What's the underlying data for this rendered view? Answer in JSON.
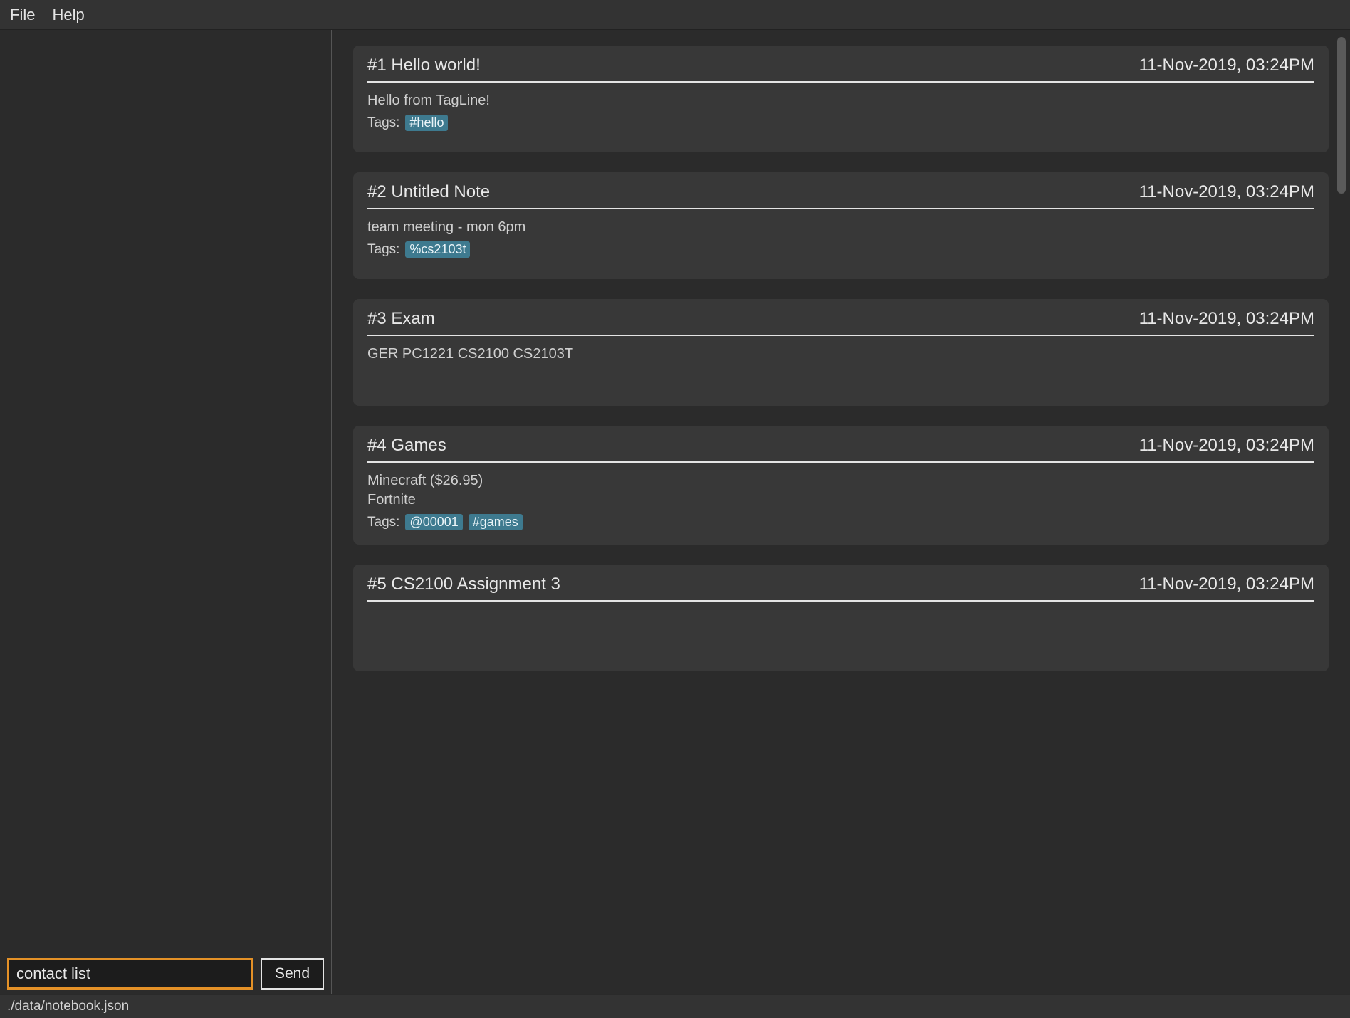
{
  "menubar": {
    "file": "File",
    "help": "Help"
  },
  "command": {
    "value": "contact list",
    "send_label": "Send"
  },
  "status": {
    "path": "./data/notebook.json"
  },
  "labels": {
    "tags_prefix": "Tags:"
  },
  "notes": [
    {
      "index": "#1",
      "title": "Hello world!",
      "date": "11-Nov-2019, 03:24PM",
      "body": "Hello from TagLine!",
      "tags": [
        "#hello"
      ]
    },
    {
      "index": "#2",
      "title": "Untitled Note",
      "date": "11-Nov-2019, 03:24PM",
      "body": "team meeting - mon 6pm",
      "tags": [
        "%cs2103t"
      ]
    },
    {
      "index": "#3",
      "title": "Exam",
      "date": "11-Nov-2019, 03:24PM",
      "body": "GER PC1221 CS2100 CS2103T",
      "tags": []
    },
    {
      "index": "#4",
      "title": "Games",
      "date": "11-Nov-2019, 03:24PM",
      "body": "Minecraft ($26.95)\nFortnite",
      "tags": [
        "@00001",
        "#games"
      ]
    },
    {
      "index": "#5",
      "title": "CS2100 Assignment 3",
      "date": "11-Nov-2019, 03:24PM",
      "body": "",
      "tags": []
    }
  ]
}
